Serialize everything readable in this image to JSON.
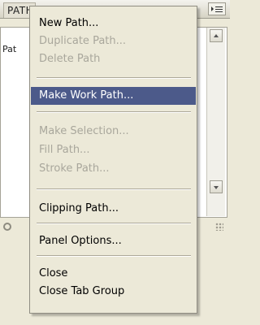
{
  "panel": {
    "tab_label": "PATHS",
    "row_label": "Pat"
  },
  "menu": {
    "items": [
      {
        "label": "New Path...",
        "enabled": true
      },
      {
        "label": "Duplicate Path...",
        "enabled": false
      },
      {
        "label": "Delete Path",
        "enabled": false
      },
      {
        "label": "Make Work Path...",
        "enabled": true,
        "highlighted": true
      },
      {
        "label": "Make Selection...",
        "enabled": false
      },
      {
        "label": "Fill Path...",
        "enabled": false
      },
      {
        "label": "Stroke Path...",
        "enabled": false
      },
      {
        "label": "Clipping Path...",
        "enabled": true
      },
      {
        "label": "Panel Options...",
        "enabled": true
      },
      {
        "label": "Close",
        "enabled": true
      },
      {
        "label": "Close Tab Group",
        "enabled": true
      }
    ]
  },
  "colors": {
    "highlight": "#4c5a8a",
    "disabled_text": "#a9a79c",
    "menu_bg": "#ece9d8"
  },
  "icons": {
    "panel_menu": "panel-menu-icon",
    "scroll_up": "scroll-up-arrow-icon",
    "scroll_down": "scroll-down-arrow-icon",
    "resize": "resize-grip-icon"
  }
}
